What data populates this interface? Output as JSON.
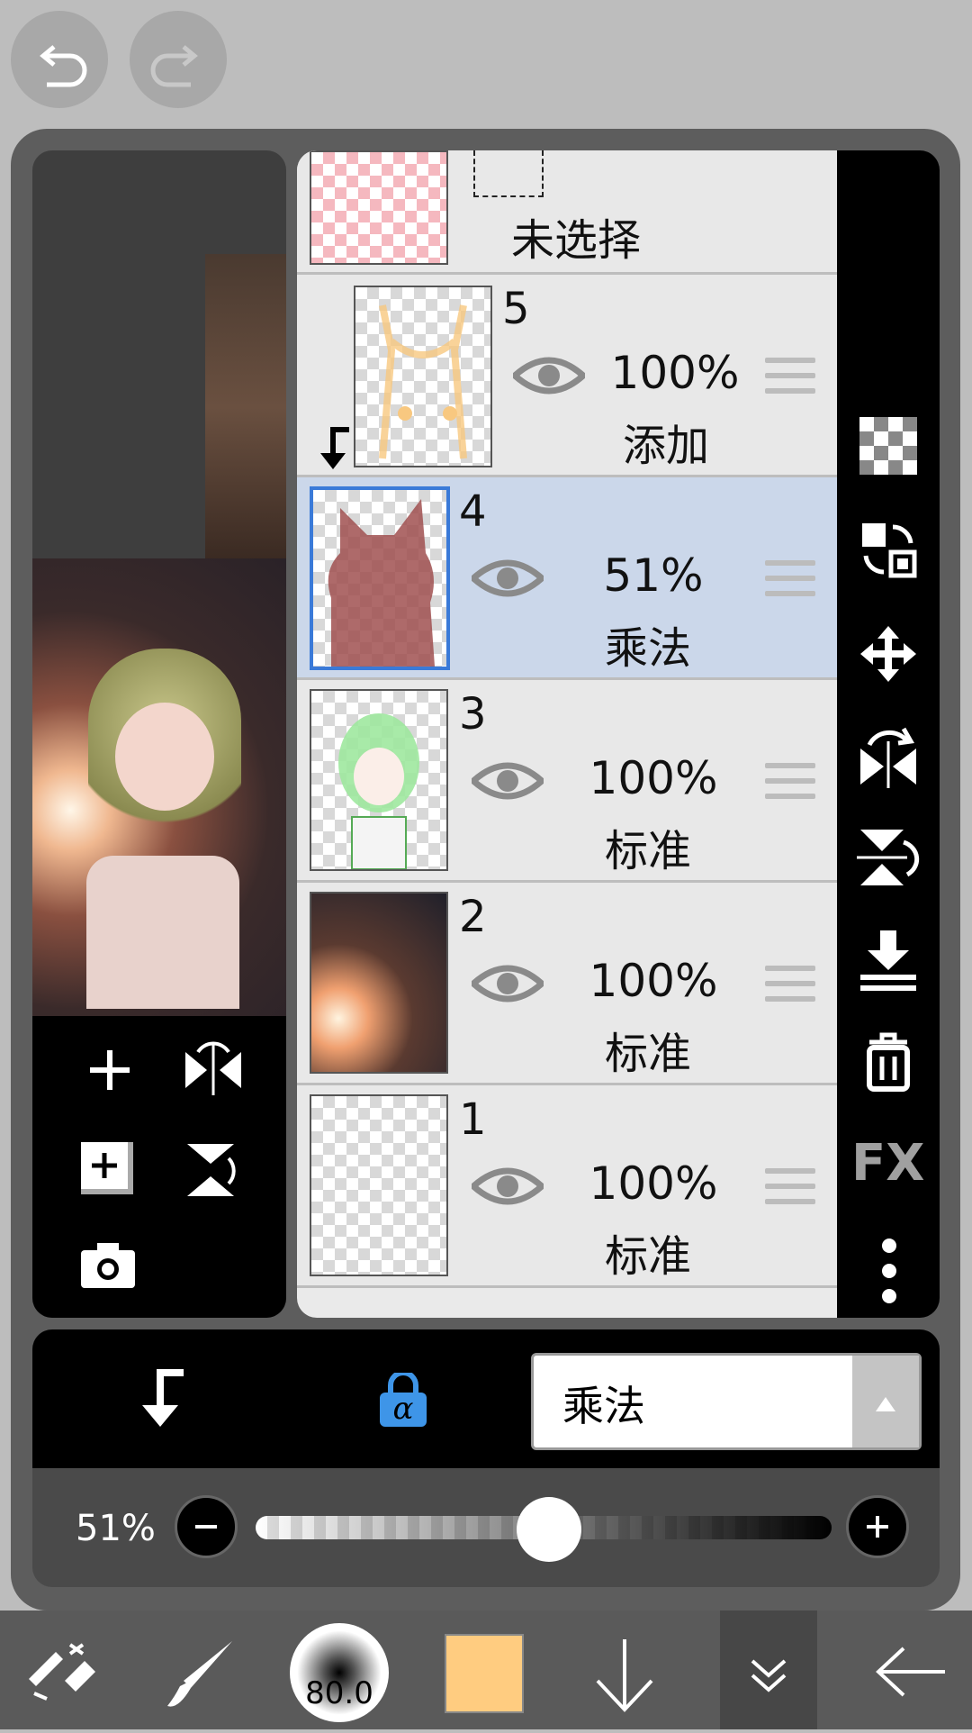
{
  "top": {
    "undo_icon": "undo-icon",
    "redo_icon": "redo-icon"
  },
  "layers": {
    "unselected_label": "未选择",
    "items": [
      {
        "number": "5",
        "opacity": "100%",
        "mode": "添加",
        "clipped": true,
        "thumb": "checker-pink-outline"
      },
      {
        "number": "4",
        "opacity": "51%",
        "mode": "乘法",
        "selected": true
      },
      {
        "number": "3",
        "opacity": "100%",
        "mode": "标准"
      },
      {
        "number": "2",
        "opacity": "100%",
        "mode": "标准"
      },
      {
        "number": "1",
        "opacity": "100%",
        "mode": "标准"
      }
    ]
  },
  "right_toolbar": [
    "transparency-checker-icon",
    "layer-swap-icon",
    "move-icon",
    "flip-horizontal-icon",
    "flip-vertical-icon",
    "merge-down-icon",
    "trash-icon",
    "fx-icon",
    "more-icon"
  ],
  "right_toolbar_labels": {
    "fx": "FX"
  },
  "blend": {
    "clip_icon": "clip-arrow-icon",
    "alpha_lock_icon": "alpha-lock-icon",
    "mode_value": "乘法",
    "alpha_symbol": "α"
  },
  "opacity": {
    "label": "51%",
    "value": 0.51
  },
  "bottom_toolbar": {
    "brush_size": "80.0",
    "color": "#ffcc80"
  },
  "colors": {
    "selected_row": "#cbd7ea",
    "accent_blue": "#3e95e8"
  }
}
